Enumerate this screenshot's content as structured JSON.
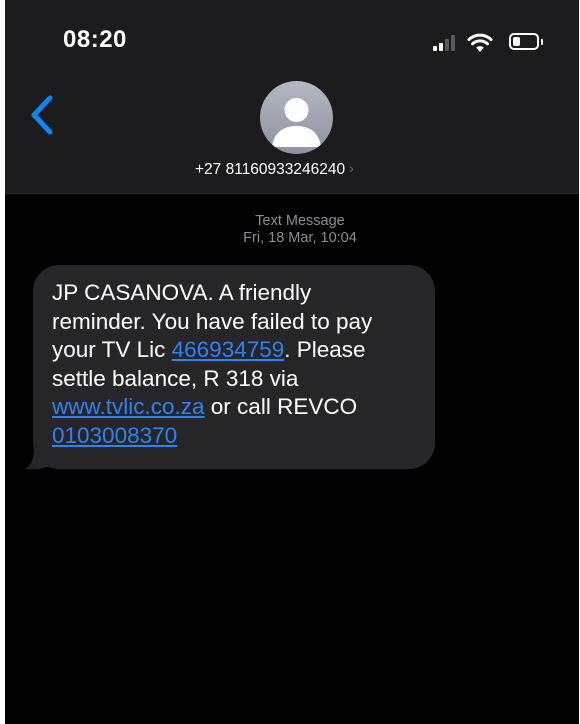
{
  "status_bar": {
    "time": "08:20"
  },
  "contact": {
    "number": "+27 81160933246240",
    "chevron": "›"
  },
  "thread": {
    "message_type": "Text Message",
    "date_time": "Fri, 18 Mar, 10:04"
  },
  "message": {
    "line1": "JP CASANOVA. A friendly",
    "line2": "reminder. You have failed to pay",
    "line3_text": "your TV Lic ",
    "line3_link": "466934759",
    "line3_after": ". Please",
    "line4": "settle balance, R 318 via",
    "line5_link": "www.tvlic.co.za",
    "line5_after": " or call REVCO",
    "line6_link": "0103008370"
  },
  "colors": {
    "background": "#000000",
    "header_background": "#1c1c1e",
    "bubble": "#262629",
    "link": "#2f82f4",
    "back_accent": "#0a84ff",
    "secondary_text": "#8e8e93"
  },
  "icons": {
    "signal": "cellular-signal-icon",
    "wifi": "wifi-icon",
    "battery": "battery-icon",
    "back": "chevron-left-icon",
    "avatar": "person-silhouette-icon",
    "contact_details": "chevron-right-icon"
  }
}
